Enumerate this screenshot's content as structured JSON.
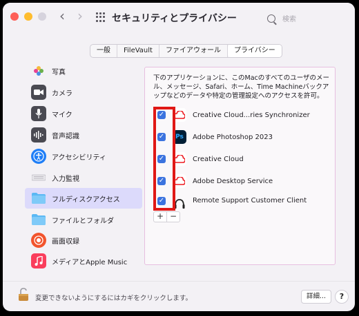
{
  "window": {
    "title": "セキュリティとプライバシー"
  },
  "search": {
    "placeholder": "検索"
  },
  "tabs": [
    {
      "label": "一般"
    },
    {
      "label": "FileVault"
    },
    {
      "label": "ファイアウォール"
    },
    {
      "label": "プライバシー",
      "selected": true
    }
  ],
  "sidebar": {
    "items": [
      {
        "label": "写真",
        "icon": "photos-icon",
        "color": "#ffffff"
      },
      {
        "label": "カメラ",
        "icon": "camera-icon",
        "color": "#4a4a52"
      },
      {
        "label": "マイク",
        "icon": "microphone-icon",
        "color": "#4a4a52"
      },
      {
        "label": "音声認識",
        "icon": "waveform-icon",
        "color": "#4a4a52"
      },
      {
        "label": "アクセシビリティ",
        "icon": "accessibility-icon",
        "color": "#1f7ef7"
      },
      {
        "label": "入力監視",
        "icon": "keyboard-icon",
        "color": "#e7e6ea"
      },
      {
        "label": "フルディスクアクセス",
        "icon": "folder-icon",
        "color": "#5ab8f4",
        "selected": true
      },
      {
        "label": "ファイルとフォルダ",
        "icon": "folder-icon",
        "color": "#5ab8f4"
      },
      {
        "label": "画面収録",
        "icon": "screen-record-icon",
        "color": "#f2542d"
      },
      {
        "label": "メディアとApple Music",
        "icon": "music-icon",
        "color": "#fa3e5c"
      }
    ]
  },
  "panel": {
    "description": "下のアプリケーションに、このMacのすべてのユーザのメール、メッセージ、Safari、ホーム、Time Machineバックアップなどのデータや特定の管理設定へのアクセスを許可。",
    "apps": [
      {
        "name": "Creative Cloud...ries Synchronizer",
        "icon": "creative-cloud-icon",
        "checked": true
      },
      {
        "name": "Adobe Photoshop 2023",
        "icon": "photoshop-icon",
        "icon_text": "Ps",
        "checked": true
      },
      {
        "name": "Creative Cloud",
        "icon": "creative-cloud-icon",
        "checked": true
      },
      {
        "name": "Adobe Desktop Service",
        "icon": "creative-cloud-icon",
        "checked": true
      },
      {
        "name": "Remote Support Customer Client",
        "icon": "headset-icon",
        "checked": true
      }
    ],
    "add_label": "+",
    "remove_label": "−"
  },
  "footer": {
    "lock_text": "変更できないようにするにはカギをクリックします。",
    "details_label": "詳細...",
    "help_label": "?"
  },
  "colors": {
    "accent": "#3b73df",
    "highlight": "#e01815"
  }
}
